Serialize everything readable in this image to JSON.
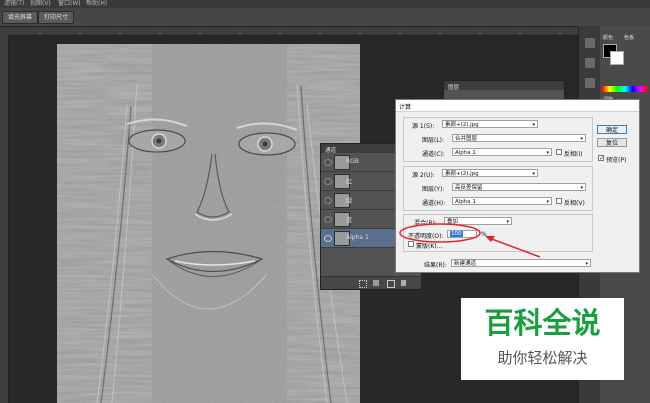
{
  "menubar": {
    "items": [
      "滤镜(T)",
      "视图(V)",
      "窗口(W)",
      "帮助(H)"
    ]
  },
  "options_bar": {
    "fill_screen_label": "填充屏幕",
    "print_size_label": "打印尺寸"
  },
  "right_panel": {
    "color_tab": "颜色",
    "swatches_tab": "色板",
    "adjustments_tab": "调整"
  },
  "layers_panel": {
    "title": "图层"
  },
  "channels_panel": {
    "title": "通道",
    "channels": [
      {
        "label": "RGB"
      },
      {
        "label": "红"
      },
      {
        "label": "绿"
      },
      {
        "label": "蓝"
      },
      {
        "label": "Alpha 1"
      }
    ],
    "selected_index": 4
  },
  "dialog": {
    "title": "计算",
    "source1": {
      "label": "源 1(S):",
      "value": "素颜+(2).jpg",
      "layer_label": "图层(L):",
      "layer_value": "合并图层",
      "channel_label": "通道(C):",
      "channel_value": "Alpha 1",
      "invert_label": "反相(I)"
    },
    "source2": {
      "label": "源 2(U):",
      "value": "素颜+(2).jpg",
      "layer_label": "图层(Y):",
      "layer_value": "高反差保留",
      "channel_label": "通道(H):",
      "channel_value": "Alpha 1",
      "invert_label": "反相(V)"
    },
    "blending": {
      "label": "混合(B):",
      "value": "叠加",
      "opacity_label": "不透明度(O):",
      "opacity_value": "100",
      "percent": "%",
      "mask_label": "蒙版(K)..."
    },
    "result": {
      "label": "结果(R):",
      "value": "新建通道"
    },
    "buttons": {
      "ok": "确定",
      "reset": "复位",
      "preview": "预览(P)"
    }
  },
  "watermark": {
    "title": "百科全说",
    "subtitle": "助你轻松解决"
  },
  "colors": {
    "annotation_red": "#e0262a",
    "watermark_green": "#1b9e3e",
    "selection_blue": "#5a6e8e"
  }
}
